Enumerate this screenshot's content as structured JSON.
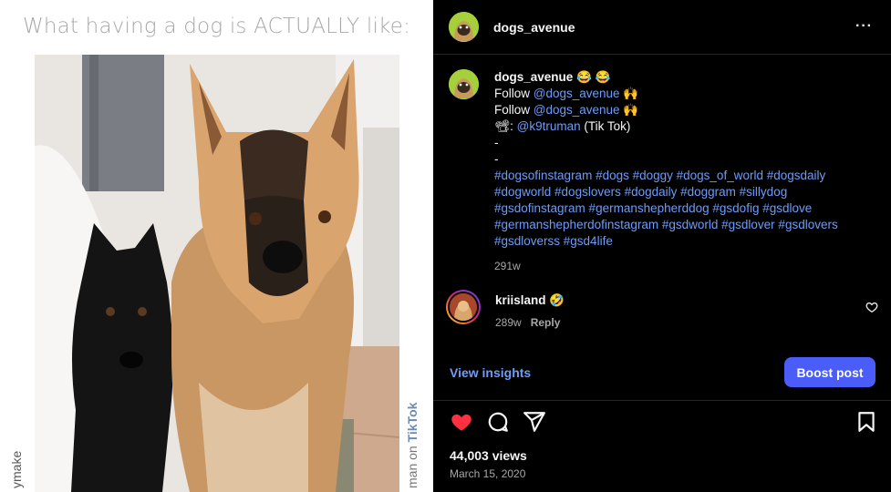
{
  "media": {
    "caption": "What having a dog is ACTUALLY like:",
    "watermark_left": "ymake",
    "watermark_right_prefix": "man on ",
    "watermark_right_brand": "TikTok"
  },
  "header": {
    "username": "dogs_avenue",
    "more_label": "···"
  },
  "post_caption": {
    "username": "dogs_avenue",
    "emoji_after_name": "😂 😂",
    "line1_prefix": "Follow ",
    "line1_link": "@dogs_avenue",
    "line1_suffix": " 🙌",
    "line2_prefix": "Follow ",
    "line2_link": "@dogs_avenue",
    "line2_suffix": " 🙌",
    "line3_prefix": "📽: ",
    "line3_link": "@k9truman",
    "line3_suffix": " (Tik Tok)",
    "dash1": "-",
    "dash2": "-",
    "hashtags": "#dogsofinstagram #dogs #doggy #dogs_of_world #dogsdaily #dogworld #dogslovers #dogdaily #doggram #sillydog #gsdofinstagram #germanshepherddog #gsdofig #gsdlove #germanshepherdofinstagram #gsdworld #gsdlover #gsdlovers #gsdloverss #gsd4life",
    "time_ago": "291w"
  },
  "comment": {
    "username": "kriisland",
    "text": "🤣",
    "time_ago": "289w",
    "reply_label": "Reply"
  },
  "insights": {
    "view_label": "View insights",
    "boost_label": "Boost post"
  },
  "stats": {
    "views": "44,003 views",
    "date": "March 15, 2020"
  },
  "colors": {
    "link": "#6e9cf7",
    "boost": "#4a5df9",
    "like": "#ff3040"
  },
  "icons": {
    "like": "heart-filled-icon",
    "comment": "comment-bubble-icon",
    "share": "paper-plane-icon",
    "save": "bookmark-icon"
  }
}
